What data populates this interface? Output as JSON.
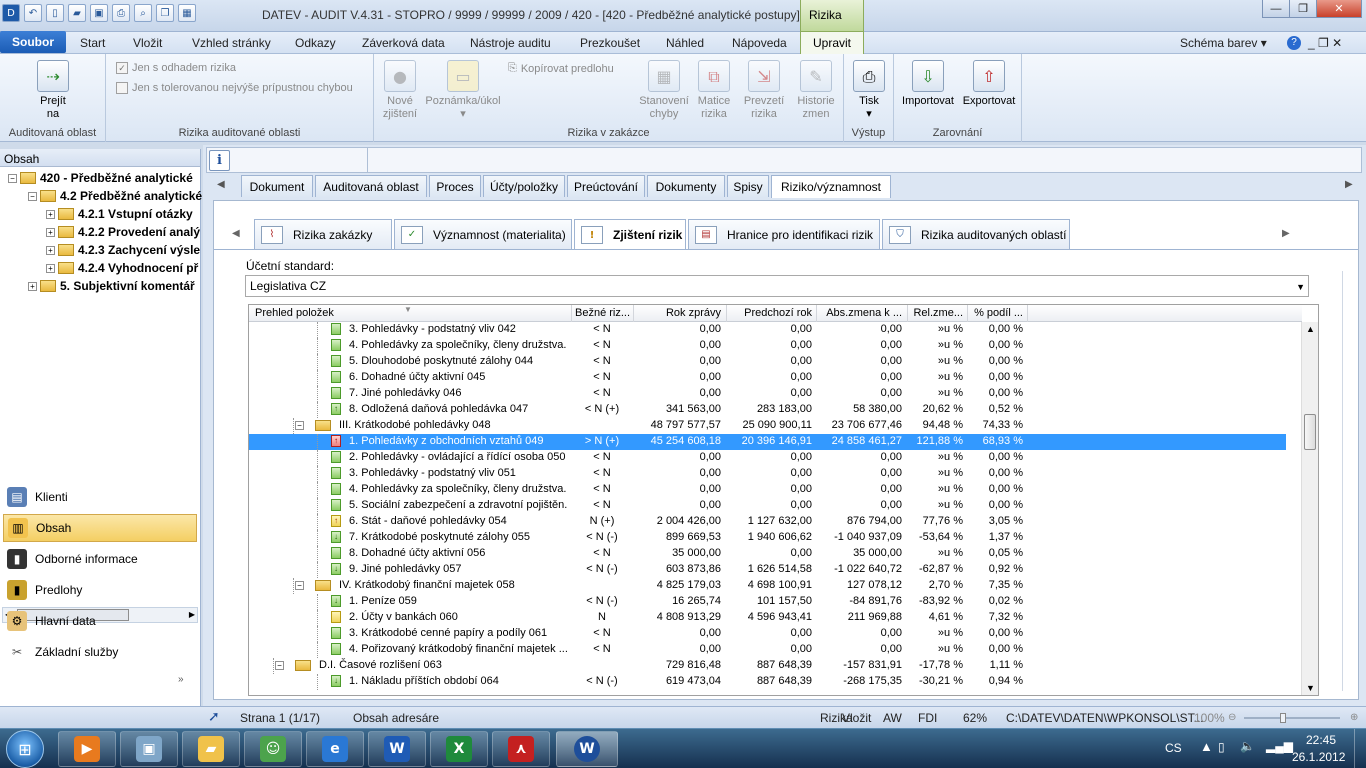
{
  "window": {
    "title": "DATEV - AUDIT V.4.31 - STOPRO / 9999 / 99999 / 2009 / 420   -   [420 - Předběžné analytické postupy]",
    "context_tab": "Rizika",
    "min": "—",
    "max": "❐",
    "close": "✕"
  },
  "menu": {
    "file": "Soubor",
    "items": [
      "Start",
      "Vložit",
      "Vzhled stránky",
      "Odkazy",
      "Záverková data",
      "Nástroje auditu",
      "Prezkoušet",
      "Náhled",
      "Nápoveda"
    ],
    "active": "Upravit",
    "schema": "Schéma barev",
    "help": "?"
  },
  "ribbon": {
    "g1": {
      "label": "Auditovaná oblast",
      "btn": "Prejít\nna"
    },
    "g2": {
      "label": "Rizika auditované oblasti",
      "chk1": "Jen s odhadem rizika",
      "chk2": "Jen s tolerovanou nejvýše prípustnou chybou"
    },
    "g3": {
      "label": "Rizika v zakázce",
      "btn1": "Nové\nzjištení",
      "btn2": "Poznámka/úkol",
      "copy": "Kopírovat predlohu",
      "btn3": "Stanovení\nchyby",
      "btn4": "Matice\nrizika",
      "btn5": "Prevzetí\nrizika",
      "btn6": "Historie\nzmen"
    },
    "g4": {
      "label": "Výstup",
      "btn": "Tisk"
    },
    "g5": {
      "label": "Zarovnání",
      "btn1": "Importovat",
      "btn2": "Exportovat"
    }
  },
  "left": {
    "header": "Obsah",
    "tree": [
      "420 - Předběžné analytické",
      "4.2 Předběžné analytické",
      "4.2.1 Vstupní otázky",
      "4.2.2 Provedení analý",
      "4.2.3 Zachycení výsle",
      "4.2.4 Vyhodnocení př",
      "5. Subjektivní komentář"
    ],
    "nav": [
      "Klienti",
      "Obsah",
      "Odborné informace",
      "Predlohy",
      "Hlavní data",
      "Základní služby"
    ]
  },
  "tabs1": [
    "Dokument",
    "Auditovaná oblast",
    "Proces",
    "Účty/položky",
    "Preúctování",
    "Dokumenty",
    "Spisy",
    "Riziko/významnost"
  ],
  "tabs2": [
    "Rizika zakázky",
    "Významnost (materialita)",
    "Zjištení rizik",
    "Hranice pro identifikaci rizik",
    "Rizika auditovaných oblastí"
  ],
  "standard": {
    "label": "Účetní standard:",
    "value": "Legislativa CZ"
  },
  "grid": {
    "headers": [
      "Prehled položek",
      "Bežné riz...",
      "Rok zprávy",
      "Predchozí rok",
      "Abs.zmena k ...",
      "Rel.zme...",
      "% podíl ..."
    ],
    "rows": [
      {
        "name": "3. Pohledávky - podstatný vliv 042",
        "risk": "< N",
        "cur": "0,00",
        "prev": "0,00",
        "abs": "0,00",
        "rel": "»u %",
        "pct": "0,00 %",
        "icon": "g"
      },
      {
        "name": "4. Pohledávky za společníky, členy družstva.",
        "risk": "< N",
        "cur": "0,00",
        "prev": "0,00",
        "abs": "0,00",
        "rel": "»u %",
        "pct": "0,00 %",
        "icon": "g"
      },
      {
        "name": "5. Dlouhodobé poskytnuté zálohy 044",
        "risk": "< N",
        "cur": "0,00",
        "prev": "0,00",
        "abs": "0,00",
        "rel": "»u %",
        "pct": "0,00 %",
        "icon": "g"
      },
      {
        "name": "6. Dohadné účty aktivní 045",
        "risk": "< N",
        "cur": "0,00",
        "prev": "0,00",
        "abs": "0,00",
        "rel": "»u %",
        "pct": "0,00 %",
        "icon": "g"
      },
      {
        "name": "7. Jiné pohledávky 046",
        "risk": "< N",
        "cur": "0,00",
        "prev": "0,00",
        "abs": "0,00",
        "rel": "»u %",
        "pct": "0,00 %",
        "icon": "g"
      },
      {
        "name": "8. Odložená daňová pohledávka 047",
        "risk": "< N (+)",
        "cur": "341 563,00",
        "prev": "283 183,00",
        "abs": "58 380,00",
        "rel": "20,62 %",
        "pct": "0,52 %",
        "icon": "gu"
      },
      {
        "name": "III. Krátkodobé pohledávky 048",
        "risk": "",
        "cur": "48 797 577,57",
        "prev": "25 090 900,11",
        "abs": "23 706 677,46",
        "rel": "94,48 %",
        "pct": "74,33 %",
        "icon": "f"
      },
      {
        "name": "1. Pohledávky z obchodních vztahů 049",
        "risk": "> N (+)",
        "cur": "45 254 608,18",
        "prev": "20 396 146,91",
        "abs": "24 858 461,27",
        "rel": "121,88 %",
        "pct": "68,93 %",
        "icon": "r"
      },
      {
        "name": "2. Pohledávky - ovládající a řídící osoba 050",
        "risk": "< N",
        "cur": "0,00",
        "prev": "0,00",
        "abs": "0,00",
        "rel": "»u %",
        "pct": "0,00 %",
        "icon": "g"
      },
      {
        "name": "3. Pohledávky - podstatný vliv 051",
        "risk": "< N",
        "cur": "0,00",
        "prev": "0,00",
        "abs": "0,00",
        "rel": "»u %",
        "pct": "0,00 %",
        "icon": "g"
      },
      {
        "name": "4. Pohledávky za společníky, členy družstva.",
        "risk": "< N",
        "cur": "0,00",
        "prev": "0,00",
        "abs": "0,00",
        "rel": "»u %",
        "pct": "0,00 %",
        "icon": "g"
      },
      {
        "name": "5. Sociální zabezpečení a zdravotní pojištěn.",
        "risk": "< N",
        "cur": "0,00",
        "prev": "0,00",
        "abs": "0,00",
        "rel": "»u %",
        "pct": "0,00 %",
        "icon": "g"
      },
      {
        "name": "6. Stát - daňové pohledávky 054",
        "risk": "N (+)",
        "cur": "2 004 426,00",
        "prev": "1 127 632,00",
        "abs": "876 794,00",
        "rel": "77,76 %",
        "pct": "3,05 %",
        "icon": "y"
      },
      {
        "name": "7. Krátkodobé poskytnuté zálohy 055",
        "risk": "< N (-)",
        "cur": "899 669,53",
        "prev": "1 940 606,62",
        "abs": "-1 040 937,09",
        "rel": "-53,64 %",
        "pct": "1,37 %",
        "icon": "gd"
      },
      {
        "name": "8. Dohadné účty aktivní 056",
        "risk": "< N",
        "cur": "35 000,00",
        "prev": "0,00",
        "abs": "35 000,00",
        "rel": "»u %",
        "pct": "0,05 %",
        "icon": "g"
      },
      {
        "name": "9. Jiné pohledávky 057",
        "risk": "< N (-)",
        "cur": "603 873,86",
        "prev": "1 626 514,58",
        "abs": "-1 022 640,72",
        "rel": "-62,87 %",
        "pct": "0,92 %",
        "icon": "gd"
      },
      {
        "name": "IV. Krátkodobý finanční majetek 058",
        "risk": "",
        "cur": "4 825 179,03",
        "prev": "4 698 100,91",
        "abs": "127 078,12",
        "rel": "2,70 %",
        "pct": "7,35 %",
        "icon": "f"
      },
      {
        "name": "1. Peníze 059",
        "risk": "< N (-)",
        "cur": "16 265,74",
        "prev": "101 157,50",
        "abs": "-84 891,76",
        "rel": "-83,92 %",
        "pct": "0,02 %",
        "icon": "gd"
      },
      {
        "name": "2. Účty v bankách 060",
        "risk": "N",
        "cur": "4 808 913,29",
        "prev": "4 596 943,41",
        "abs": "211 969,88",
        "rel": "4,61 %",
        "pct": "7,32 %",
        "icon": "y0"
      },
      {
        "name": "3. Krátkodobé cenné papíry a podíly 061",
        "risk": "< N",
        "cur": "0,00",
        "prev": "0,00",
        "abs": "0,00",
        "rel": "»u %",
        "pct": "0,00 %",
        "icon": "g"
      },
      {
        "name": "4. Pořizovaný krátkodobý finanční majetek ...",
        "risk": "< N",
        "cur": "0,00",
        "prev": "0,00",
        "abs": "0,00",
        "rel": "»u %",
        "pct": "0,00 %",
        "icon": "g"
      },
      {
        "name": "D.I. Časové rozlišení 063",
        "risk": "",
        "cur": "729 816,48",
        "prev": "887 648,39",
        "abs": "-157 831,91",
        "rel": "-17,78 %",
        "pct": "1,11 %",
        "icon": "f"
      },
      {
        "name": "1. Nákladu příštích období 064",
        "risk": "< N (-)",
        "cur": "619 473,04",
        "prev": "887 648,39",
        "abs": "-268 175,35",
        "rel": "-30,21 %",
        "pct": "0,94 %",
        "icon": "gd"
      }
    ]
  },
  "status": {
    "page": "Strana 1 (1/17)",
    "content": "Obsah adresáre",
    "rizika": "Rizika",
    "vlozit": "Vložit",
    "aw": "AW",
    "fdi": "FDI",
    "pct": "62%",
    "path": "C:\\DATEV\\DATEN\\WPKONSOL\\ST...",
    "zoom": "100%"
  },
  "taskbar": {
    "lang": "CS",
    "time": "22:45",
    "date": "26.1.2012"
  }
}
